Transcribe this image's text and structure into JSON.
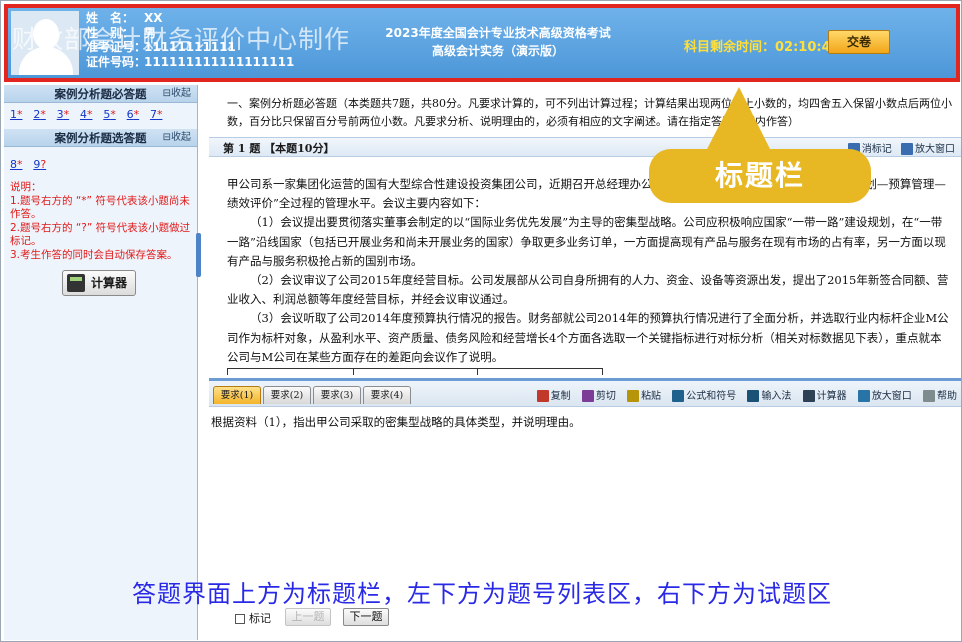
{
  "header": {
    "watermark": "财政部会计财务评价中心制作",
    "candidate": [
      {
        "key": "姓　名：",
        "value": "XX"
      },
      {
        "key": "性　别：",
        "value": "男"
      },
      {
        "key": "准考证号：",
        "value": "11111111111"
      },
      {
        "key": "证件号码：",
        "value": "111111111111111111"
      }
    ],
    "exam_title_line1": "2023年度全国会计专业技术高级资格考试",
    "exam_title_line2": "高级会计实务（演示版）",
    "timer_label": "科目剩余时间：",
    "timer_value": "02:10:45",
    "submit_label": "交卷"
  },
  "sidebar": {
    "required_title": "案例分析题必答题",
    "required_collapse": "收起",
    "required_items": [
      {
        "num": "1",
        "mark": "*"
      },
      {
        "num": "2",
        "mark": "*"
      },
      {
        "num": "3",
        "mark": "*"
      },
      {
        "num": "4",
        "mark": "*"
      },
      {
        "num": "5",
        "mark": "*"
      },
      {
        "num": "6",
        "mark": "*"
      },
      {
        "num": "7",
        "mark": "*"
      }
    ],
    "optional_title": "案例分析题选答题",
    "optional_collapse": "收起",
    "optional_items": [
      {
        "num": "8",
        "mark": "*"
      },
      {
        "num": "9",
        "mark": "?"
      }
    ],
    "notes_title": "说明：",
    "notes": [
      "1.题号右方的 “*” 符号代表该小题尚未作答。",
      "2.题号右方的 “?” 符号代表该小题做过标记。",
      "3.考生作答的同时会自动保存答案。"
    ],
    "calculator_label": "计算器"
  },
  "main": {
    "intro": "一、案例分析题必答题（本类题共7题，共80分。凡要求计算的，可不列出计算过程；计算结果出现两位以上小数的，均四舍五入保留小数点后两位小数，百分比只保留百分号前两位小数。凡要求分析、说明理由的，必须有相应的文字阐述。请在指定答题区域内作答）",
    "question_title": "第 1 题 【本题10分】",
    "question_tools": [
      "消标记",
      "放大窗口"
    ],
    "stem": [
      "甲公司系一家集团化运营的国有大型综合性建设投资集团公司，近期召开总经理办公会，提出要进一步提升“战略规划—年度计划—预算管理—绩效评价”全过程的管理水平。会议主要内容如下：",
      "（1）会议提出要贯彻落实董事会制定的以“国际业务优先发展”为主导的密集型战略。公司应积极响应国家“一带一路”建设规划，在“一带一路”沿线国家（包括已开展业务和尚未开展业务的国家）争取更多业务订单，一方面提高现有产品与服务在现有市场的占有率，另一方面以现有产品与服务积极抢占新的国别市场。",
      "（2）会议审议了公司2015年度经营目标。公司发展部从公司自身所拥有的人力、资金、设备等资源出发，提出了2015年新签合同额、营业收入、利润总额等年度经营目标，并经会议审议通过。",
      "（3）会议听取了公司2014年度预算执行情况的报告。财务部就公司2014年的预算执行情况进行了全面分析，并选取行业内标杆企业M公司作为标杆对象，从盈利水平、资产质量、债务风险和经营增长4个方面各选取一个关键指标进行对标分析（相关对标数据见下表），重点就本公司与M公司在某些方面存在的差距向会议作了说明。"
    ],
    "req_tabs": [
      "要求(1)",
      "要求(2)",
      "要求(3)",
      "要求(4)"
    ],
    "tools": [
      {
        "label": "复制",
        "icon": "copy-icon",
        "color": "#c0392b"
      },
      {
        "label": "剪切",
        "icon": "cut-icon",
        "color": "#7d3c98"
      },
      {
        "label": "粘贴",
        "icon": "paste-icon",
        "color": "#b7950b"
      },
      {
        "label": "公式和符号",
        "icon": "sigma-icon",
        "color": "#1f618d"
      },
      {
        "label": "输入法",
        "icon": "keyboard-icon",
        "color": "#1a5276"
      },
      {
        "label": "计算器",
        "icon": "calculator-icon",
        "color": "#2e4053"
      },
      {
        "label": "放大窗口",
        "icon": "enlarge-icon",
        "color": "#2874a6"
      },
      {
        "label": "帮助",
        "icon": "help-icon",
        "color": "#7f8c8d"
      }
    ],
    "requirement_text": "根据资料（1），指出甲公司采取的密集型战略的具体类型，并说明理由。",
    "mark_label": "标记",
    "prev_label": "上一题",
    "next_label": "下一题"
  },
  "overlay": {
    "callout_label": "标题栏",
    "caption": "答题界面上方为标题栏，左下方为题号列表区，右下方为试题区",
    "accent": "#e8b824",
    "highlight": "#e0261e"
  }
}
